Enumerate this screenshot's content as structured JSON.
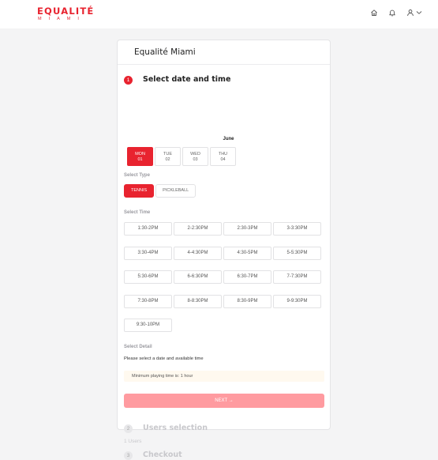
{
  "brand": {
    "name": "EQUALITÉ",
    "sub": "MIAMI",
    "color": "#e8232f"
  },
  "topbar": {
    "icons": [
      "home-icon",
      "bell-icon",
      "user-icon",
      "chevron-down-icon"
    ]
  },
  "card": {
    "title": "Equalité Miami"
  },
  "steps": [
    {
      "number": "1",
      "label": "Select date and time",
      "active": true
    },
    {
      "number": "2",
      "label": "Users selection",
      "active": false
    },
    {
      "number": "3",
      "label": "Checkout",
      "active": false
    }
  ],
  "calendar": {
    "month": "June",
    "dates": [
      {
        "day": "MON",
        "date": "01",
        "selected": true
      },
      {
        "day": "TUE",
        "date": "02",
        "selected": false
      },
      {
        "day": "WED",
        "date": "03",
        "selected": false
      },
      {
        "day": "THU",
        "date": "04",
        "selected": false
      }
    ]
  },
  "select_type": {
    "label": "Select Type",
    "options": [
      {
        "label": "TENNIS",
        "selected": true
      },
      {
        "label": "PICKLEBALL",
        "selected": false
      }
    ]
  },
  "select_time": {
    "label": "Select Time",
    "slots": [
      "1:30-2PM",
      "2-2:30PM",
      "2:30-3PM",
      "3-3:30PM",
      "3:30-4PM",
      "4-4:30PM",
      "4:30-5PM",
      "5-5:30PM",
      "5:30-6PM",
      "6-6:30PM",
      "6:30-7PM",
      "7-7:30PM",
      "7:30-8PM",
      "8-8:30PM",
      "8:30-9PM",
      "9-9:30PM",
      "9:30-10PM"
    ]
  },
  "select_detail": {
    "label": "Select Detail",
    "text": "Please select a date and available time",
    "notice": "Minimum playing time is: 1 hour"
  },
  "next_button": {
    "label": "NEXT",
    "arrow": "→"
  },
  "users": {
    "count": "1 Users"
  }
}
